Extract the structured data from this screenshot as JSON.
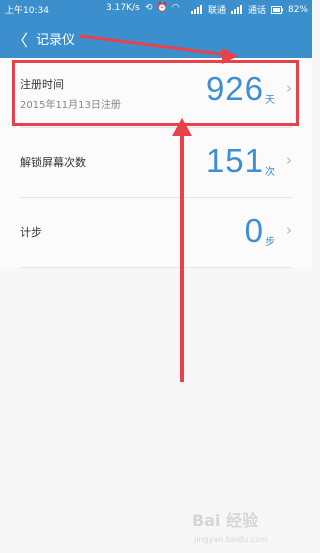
{
  "status_bar": {
    "time": "上午10:34",
    "speed": "3.17K/s",
    "carrier1": "联通",
    "carrier2": "通话",
    "battery": "82%",
    "icons": [
      "sync-icon",
      "alarm-icon",
      "wifi-icon",
      "signal-icon"
    ]
  },
  "app_bar": {
    "back_label": "〈",
    "title": "记录仪"
  },
  "rows": [
    {
      "label": "注册时间",
      "sub": "2015年11月13日注册",
      "value": "926",
      "unit": "天"
    },
    {
      "label": "解锁屏幕次数",
      "value": "151",
      "unit": "次"
    },
    {
      "label": "计步",
      "value": "0",
      "unit": "步"
    }
  ],
  "annotation": {
    "color": "#e8414a"
  },
  "watermark": {
    "brand": "Bai 经验",
    "site": "jingyan.baidu.com"
  }
}
